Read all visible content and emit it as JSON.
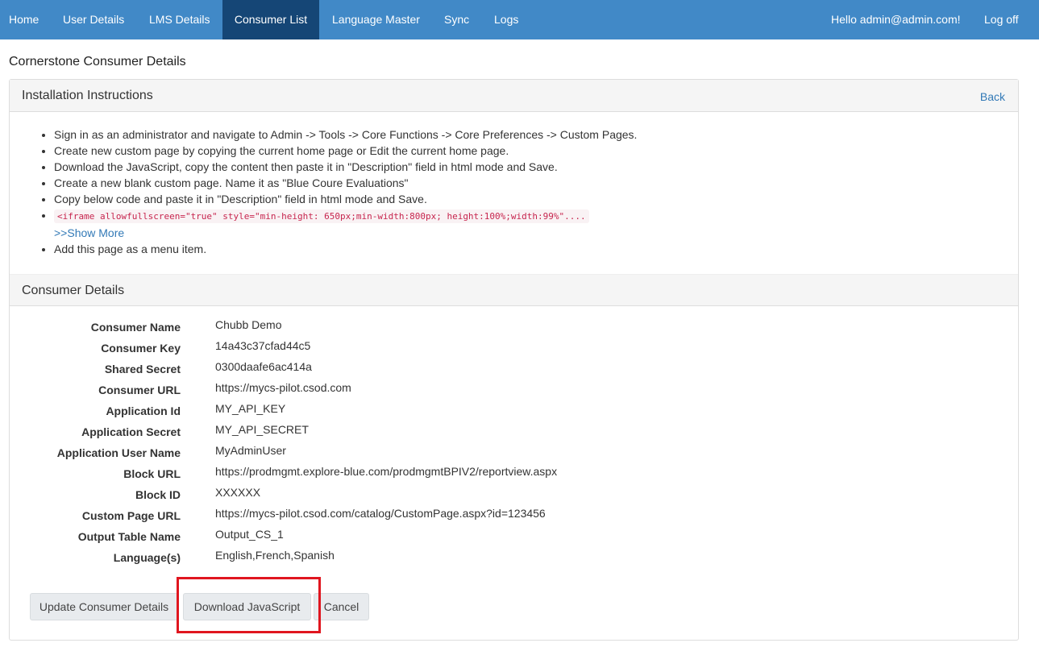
{
  "nav": {
    "items": [
      "Home",
      "User Details",
      "LMS Details",
      "Consumer List",
      "Language Master",
      "Sync",
      "Logs"
    ],
    "active": "Consumer List",
    "greeting": "Hello admin@admin.com!",
    "logoff": "Log off"
  },
  "page_title": "Cornerstone Consumer Details",
  "installation": {
    "heading": "Installation Instructions",
    "back_label": "Back",
    "steps": [
      "Sign in as an administrator and navigate to Admin -> Tools -> Core Functions -> Core Preferences -> Custom Pages.",
      "Create new custom page by copying the current home page or Edit the current home page.",
      "Download the JavaScript, copy the content then paste it in \"Description\" field in html mode and Save.",
      "Create a new blank custom page. Name it as \"Blue Coure Evaluations\"",
      "Copy below code and paste it in \"Description\" field in html mode and Save."
    ],
    "code": "<iframe allowfullscreen=\"true\" style=\"min-height: 650px;min-width:800px; height:100%;width:99%\"....",
    "show_more": ">>Show More",
    "last_step": "Add this page as a menu item."
  },
  "consumer": {
    "heading": "Consumer Details",
    "fields": [
      {
        "label": "Consumer Name",
        "value": "Chubb Demo"
      },
      {
        "label": "Consumer Key",
        "value": "14a43c37cfad44c5"
      },
      {
        "label": "Shared Secret",
        "value": "0300daafe6ac414a"
      },
      {
        "label": "Consumer URL",
        "value": "https://mycs-pilot.csod.com"
      },
      {
        "label": "Application Id",
        "value": "MY_API_KEY"
      },
      {
        "label": "Application Secret",
        "value": "MY_API_SECRET"
      },
      {
        "label": "Application User Name",
        "value": "MyAdminUser"
      },
      {
        "label": "Block URL",
        "value": "https://prodmgmt.explore-blue.com/prodmgmtBPIV2/reportview.aspx"
      },
      {
        "label": "Block ID",
        "value": "XXXXXX"
      },
      {
        "label": "Custom Page URL",
        "value": "https://mycs-pilot.csod.com/catalog/CustomPage.aspx?id=123456"
      },
      {
        "label": "Output Table Name",
        "value": "Output_CS_1"
      },
      {
        "label": "Language(s)",
        "value": "English,French,Spanish"
      }
    ]
  },
  "buttons": {
    "update": "Update Consumer Details",
    "download": "Download JavaScript",
    "cancel": "Cancel"
  },
  "colors": {
    "navbar": "#4189c7",
    "nav_active": "#154676",
    "link": "#337ab7",
    "highlight": "#e0161f"
  }
}
